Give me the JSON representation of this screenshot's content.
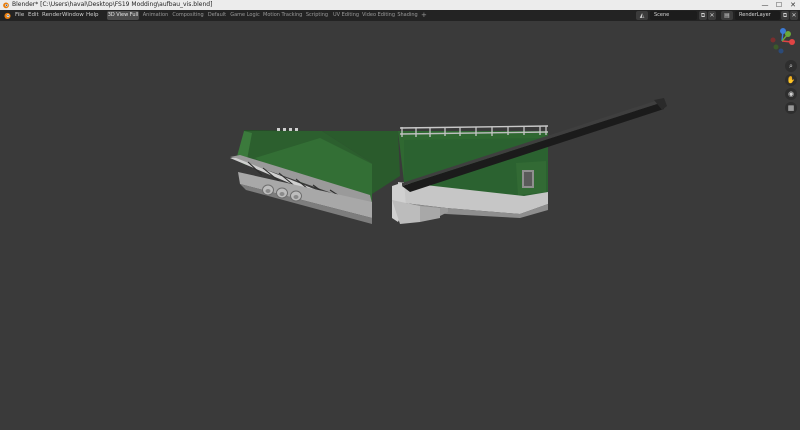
{
  "window": {
    "title": "Blender* [C:\\Users\\haval\\Desktop\\FS19 Modding\\aufbau_vis.blend]",
    "minimize": "—",
    "maximize": "☐",
    "close": "✕"
  },
  "menu": [
    "File",
    "Edit",
    "Render",
    "Window",
    "Help"
  ],
  "workspaces": [
    {
      "label": "3D View Full",
      "active": true
    },
    {
      "label": "Animation",
      "active": false
    },
    {
      "label": "Compositing",
      "active": false
    },
    {
      "label": "Default",
      "active": false
    },
    {
      "label": "Game Logic",
      "active": false
    },
    {
      "label": "Motion Tracking",
      "active": false
    },
    {
      "label": "Scripting",
      "active": false
    },
    {
      "label": "UV Editing",
      "active": false
    },
    {
      "label": "Video Editing",
      "active": false
    },
    {
      "label": "Shading",
      "active": false
    }
  ],
  "add_workspace": "+",
  "scene": {
    "label": "Scene"
  },
  "view_layer": {
    "label": "RenderLayer"
  },
  "colors": {
    "background": "#3a3a3a",
    "topbar": "#232323",
    "active_tab": "#4b4b4b",
    "model_green": "#2e6a30",
    "model_grey": "#c8c8c8",
    "axis_x": "#e04444",
    "axis_y": "#6aa83a",
    "axis_z": "#3b7ad6"
  },
  "icons": {
    "blender_logo": "blender-logo-icon",
    "zoom": "magnifier-icon",
    "pan": "hand-icon",
    "camera": "camera-icon",
    "ortho": "grid-icon"
  },
  "nav": {
    "zoom_glyph": "⌕",
    "pan_glyph": "✋",
    "camera_glyph": "◉",
    "ortho_glyph": "▦"
  }
}
